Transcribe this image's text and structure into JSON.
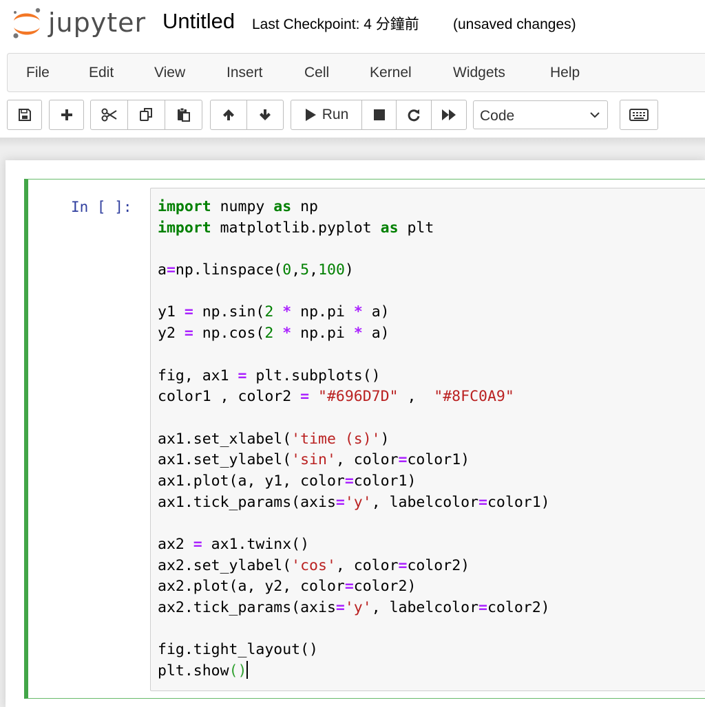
{
  "header": {
    "logo_text": "jupyter",
    "notebook_name": "Untitled",
    "checkpoint_text": "Last Checkpoint: 4 分鐘前",
    "autosave_status": "(unsaved changes)",
    "logo_colors": {
      "orange": "#F37726",
      "gray": "#767677"
    }
  },
  "menubar": {
    "items": [
      {
        "label": "File"
      },
      {
        "label": "Edit"
      },
      {
        "label": "View"
      },
      {
        "label": "Insert"
      },
      {
        "label": "Cell"
      },
      {
        "label": "Kernel"
      },
      {
        "label": "Widgets"
      },
      {
        "label": "Help"
      }
    ]
  },
  "toolbar": {
    "icons": [
      "save-icon",
      "plus-icon",
      "scissors-icon",
      "copy-icon",
      "paste-icon",
      "arrow-up-icon",
      "arrow-down-icon",
      "play-icon",
      "stop-icon",
      "restart-icon",
      "fast-forward-icon",
      "keyboard-icon"
    ],
    "run_label": "Run",
    "cell_type": {
      "selected": "Code"
    }
  },
  "cell": {
    "prompt": "In [ ]:",
    "code_lines": [
      [
        {
          "t": "import",
          "c": "kw"
        },
        {
          "t": " numpy "
        },
        {
          "t": "as",
          "c": "kw"
        },
        {
          "t": " np"
        }
      ],
      [
        {
          "t": "import",
          "c": "kw"
        },
        {
          "t": " matplotlib.pyplot "
        },
        {
          "t": "as",
          "c": "kw"
        },
        {
          "t": " plt"
        }
      ],
      [],
      [
        {
          "t": "a"
        },
        {
          "t": "=",
          "c": "op"
        },
        {
          "t": "np.linspace("
        },
        {
          "t": "0",
          "c": "num"
        },
        {
          "t": ","
        },
        {
          "t": "5",
          "c": "num"
        },
        {
          "t": ","
        },
        {
          "t": "100",
          "c": "num"
        },
        {
          "t": ")"
        }
      ],
      [],
      [
        {
          "t": "y1 "
        },
        {
          "t": "=",
          "c": "op"
        },
        {
          "t": " np.sin("
        },
        {
          "t": "2",
          "c": "num"
        },
        {
          "t": " "
        },
        {
          "t": "*",
          "c": "op"
        },
        {
          "t": " np.pi "
        },
        {
          "t": "*",
          "c": "op"
        },
        {
          "t": " a)"
        }
      ],
      [
        {
          "t": "y2 "
        },
        {
          "t": "=",
          "c": "op"
        },
        {
          "t": " np.cos("
        },
        {
          "t": "2",
          "c": "num"
        },
        {
          "t": " "
        },
        {
          "t": "*",
          "c": "op"
        },
        {
          "t": " np.pi "
        },
        {
          "t": "*",
          "c": "op"
        },
        {
          "t": " a)"
        }
      ],
      [],
      [
        {
          "t": "fig, ax1 "
        },
        {
          "t": "=",
          "c": "op"
        },
        {
          "t": " plt.subplots()"
        }
      ],
      [
        {
          "t": "color1 , color2 "
        },
        {
          "t": "=",
          "c": "op"
        },
        {
          "t": " "
        },
        {
          "t": "\"#696D7D\"",
          "c": "str"
        },
        {
          "t": " ,  "
        },
        {
          "t": "\"#8FC0A9\"",
          "c": "str"
        }
      ],
      [],
      [
        {
          "t": "ax1.set_xlabel("
        },
        {
          "t": "'time (s)'",
          "c": "str"
        },
        {
          "t": ")"
        }
      ],
      [
        {
          "t": "ax1.set_ylabel("
        },
        {
          "t": "'sin'",
          "c": "str"
        },
        {
          "t": ", color"
        },
        {
          "t": "=",
          "c": "op"
        },
        {
          "t": "color1)"
        }
      ],
      [
        {
          "t": "ax1.plot(a, y1, color"
        },
        {
          "t": "=",
          "c": "op"
        },
        {
          "t": "color1)"
        }
      ],
      [
        {
          "t": "ax1.tick_params(axis"
        },
        {
          "t": "=",
          "c": "op"
        },
        {
          "t": "'y'",
          "c": "str"
        },
        {
          "t": ", labelcolor"
        },
        {
          "t": "=",
          "c": "op"
        },
        {
          "t": "color1)"
        }
      ],
      [],
      [
        {
          "t": "ax2 "
        },
        {
          "t": "=",
          "c": "op"
        },
        {
          "t": " ax1.twinx()"
        }
      ],
      [
        {
          "t": "ax2.set_ylabel("
        },
        {
          "t": "'cos'",
          "c": "str"
        },
        {
          "t": ", color"
        },
        {
          "t": "=",
          "c": "op"
        },
        {
          "t": "color2)"
        }
      ],
      [
        {
          "t": "ax2.plot(a, y2, color"
        },
        {
          "t": "=",
          "c": "op"
        },
        {
          "t": "color2)"
        }
      ],
      [
        {
          "t": "ax2.tick_params(axis"
        },
        {
          "t": "=",
          "c": "op"
        },
        {
          "t": "'y'",
          "c": "str"
        },
        {
          "t": ", labelcolor"
        },
        {
          "t": "=",
          "c": "op"
        },
        {
          "t": "color2)"
        }
      ],
      [],
      [
        {
          "t": "fig.tight_layout()"
        }
      ],
      [
        {
          "t": "plt.show"
        },
        {
          "t": "()",
          "c": "hl"
        }
      ]
    ]
  },
  "colors": {
    "cell_border": "#42A548",
    "prompt": "#303F9F",
    "keyword": "#008000",
    "operator": "#AA22FF",
    "string": "#BA2121"
  }
}
